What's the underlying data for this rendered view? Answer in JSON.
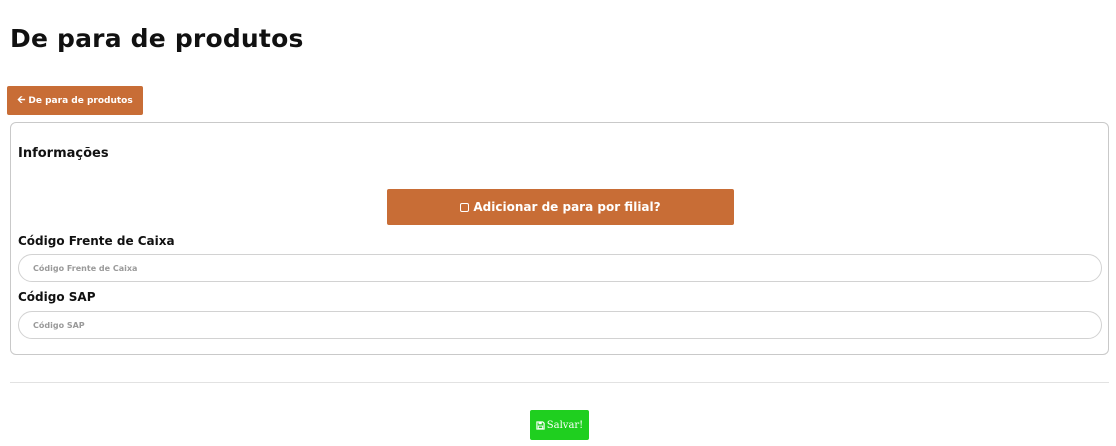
{
  "page": {
    "title": "De para de produtos"
  },
  "back_button": {
    "icon": "arrow-left-icon",
    "label": "De para de produtos"
  },
  "form": {
    "section_title": "Informações",
    "filial_button": {
      "icon": "checkbox-icon",
      "label": "Adicionar de para por filial?"
    },
    "fields": {
      "pdv_code": {
        "label": "Código Frente de Caixa",
        "placeholder": "Código Frente de Caixa",
        "value": ""
      },
      "sap_code": {
        "label": "Código SAP",
        "placeholder": "Código SAP",
        "value": ""
      }
    }
  },
  "save_button": {
    "icon": "floppy-disk-icon",
    "label": "Salvar!"
  },
  "colors": {
    "accent": "#c86d36",
    "save": "#1fcf1f",
    "border": "#c9c9c9"
  }
}
